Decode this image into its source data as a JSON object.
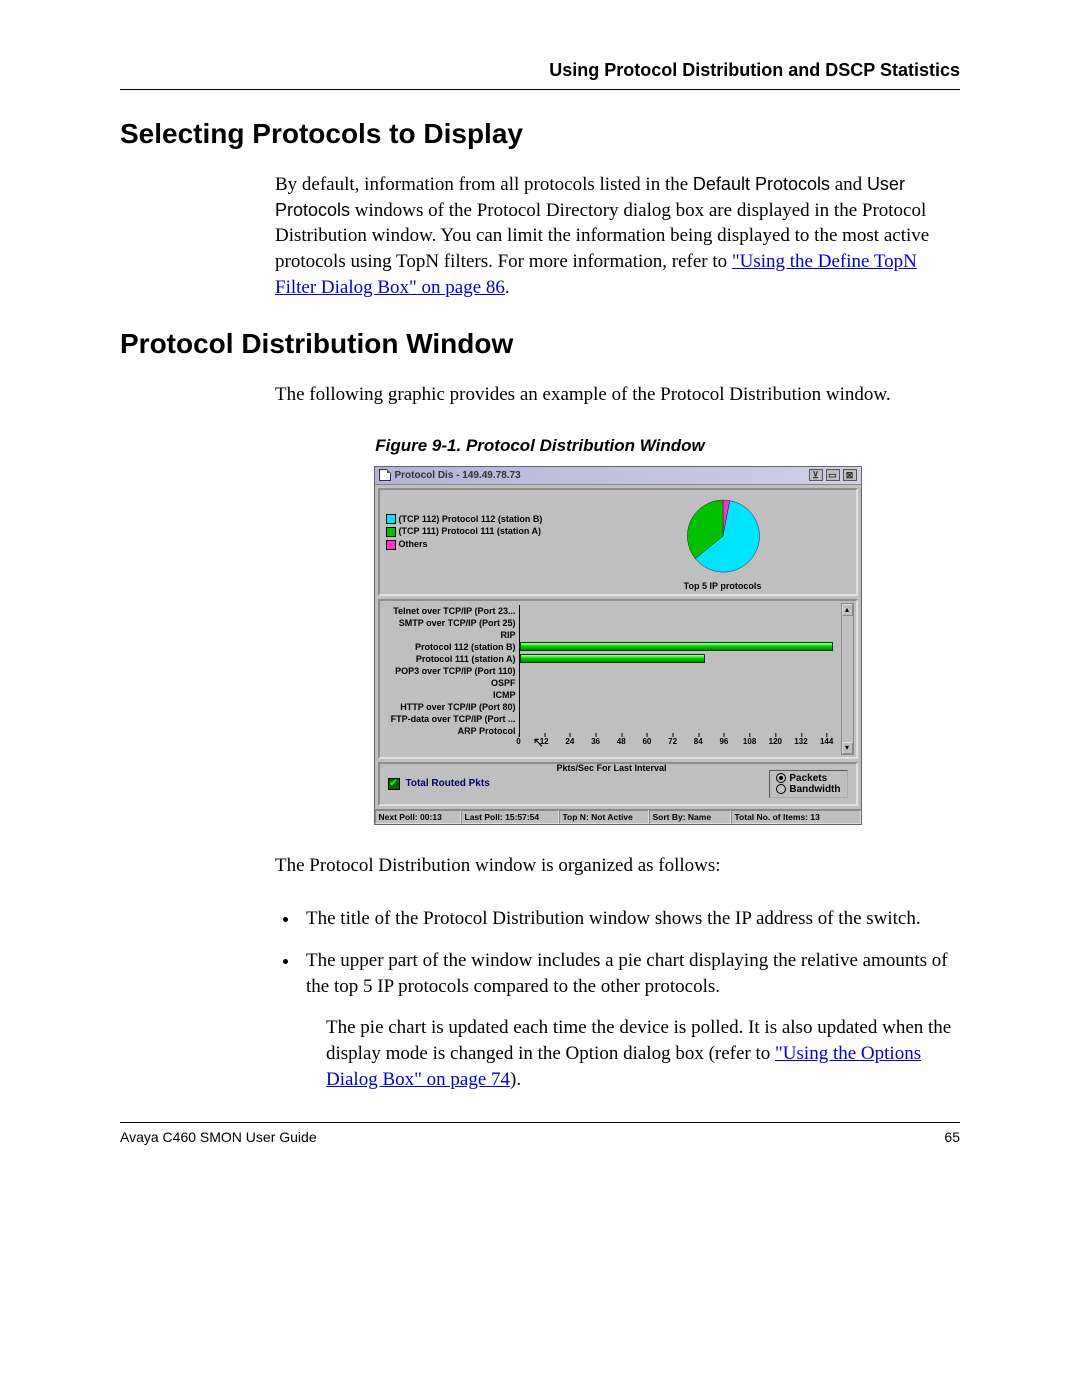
{
  "header": {
    "chapter_title": "Using Protocol Distribution and DSCP Statistics"
  },
  "section1": {
    "heading": "Selecting Protocols to Display",
    "para_parts": {
      "p1a": "By default, information from all protocols listed in the ",
      "p1b_sans": "Default Protocols",
      "p1c": " and ",
      "p1d_sans": "User Protocols",
      "p1e": " windows of the Protocol Directory dialog box are displayed in the Protocol Distribution window. You can limit the information being displayed to the most active protocols using TopN filters. For more information, refer to ",
      "link1": "\"Using the Define TopN Filter Dialog Box\" on page 86",
      "p1f": "."
    }
  },
  "section2": {
    "heading": "Protocol Distribution Window",
    "intro": "The following graphic provides an example of the Protocol Distribution window.",
    "figure_caption": "Figure 9-1.  Protocol Distribution Window",
    "after_figure": "The Protocol Distribution window is organized as follows:",
    "bullets": [
      "The title of the Protocol Distribution window shows the IP address of the switch.",
      "The upper part of the window includes a pie chart displaying the relative amounts of the top 5 IP protocols compared to the other protocols."
    ],
    "sub_para_parts": {
      "a": "The pie chart is updated each time the device is polled. It is also updated when the display mode is changed in the Option dialog box (refer to ",
      "link": "\"Using the Options Dialog Box\" on page 74",
      "b": ")."
    }
  },
  "app": {
    "title": "Protocol Dis - 149.49.78.73",
    "legend": [
      {
        "color": "#00e5ff",
        "label": "(TCP 112) Protocol 112 (station B)"
      },
      {
        "color": "#00c000",
        "label": "(TCP 111) Protocol 111 (station A)"
      },
      {
        "color": "#ff33cc",
        "label": "Others"
      }
    ],
    "pie_caption": "Top 5 IP protocols",
    "bar_axis_label": "Pkts/Sec For Last Interval",
    "bar_ticks": [
      0,
      12,
      24,
      36,
      48,
      60,
      72,
      84,
      96,
      108,
      120,
      132,
      144
    ],
    "totals_label": "Total Routed Pkts",
    "radio": {
      "packets": "Packets",
      "bandwidth": "Bandwidth",
      "selected": "packets"
    },
    "status": {
      "next_poll": "Next Poll:  00:13",
      "last_poll": "Last Poll: 15:57:54",
      "topn": "Top N: Not Active",
      "sort": "Sort By: Name",
      "total_items": "Total No. of Items: 13"
    }
  },
  "chart_data": {
    "type": "bar",
    "xlabel": "Pkts/Sec For Last Interval",
    "xlim": [
      0,
      150
    ],
    "categories": [
      "Telnet over TCP/IP (Port 23...",
      "SMTP over TCP/IP (Port 25)",
      "RIP",
      "Protocol 112 (station B)",
      "Protocol 111 (station A)",
      "POP3 over TCP/IP (Port 110)",
      "OSPF",
      "ICMP",
      "HTTP over TCP/IP (Port 80)",
      "FTP-data over TCP/IP (Port ...",
      "ARP Protocol"
    ],
    "values": [
      0,
      0,
      0,
      147,
      87,
      0,
      0,
      0,
      0,
      0,
      0
    ],
    "pie": {
      "type": "pie",
      "title": "Top 5 IP protocols",
      "series": [
        {
          "name": "(TCP 112) Protocol 112 (station B)",
          "value": 60,
          "color": "#00e5ff"
        },
        {
          "name": "(TCP 111) Protocol 111 (station A)",
          "value": 37,
          "color": "#00c000"
        },
        {
          "name": "Others",
          "value": 3,
          "color": "#ff33cc"
        }
      ]
    }
  },
  "footer": {
    "left": "Avaya C460 SMON User Guide",
    "right": "65"
  }
}
